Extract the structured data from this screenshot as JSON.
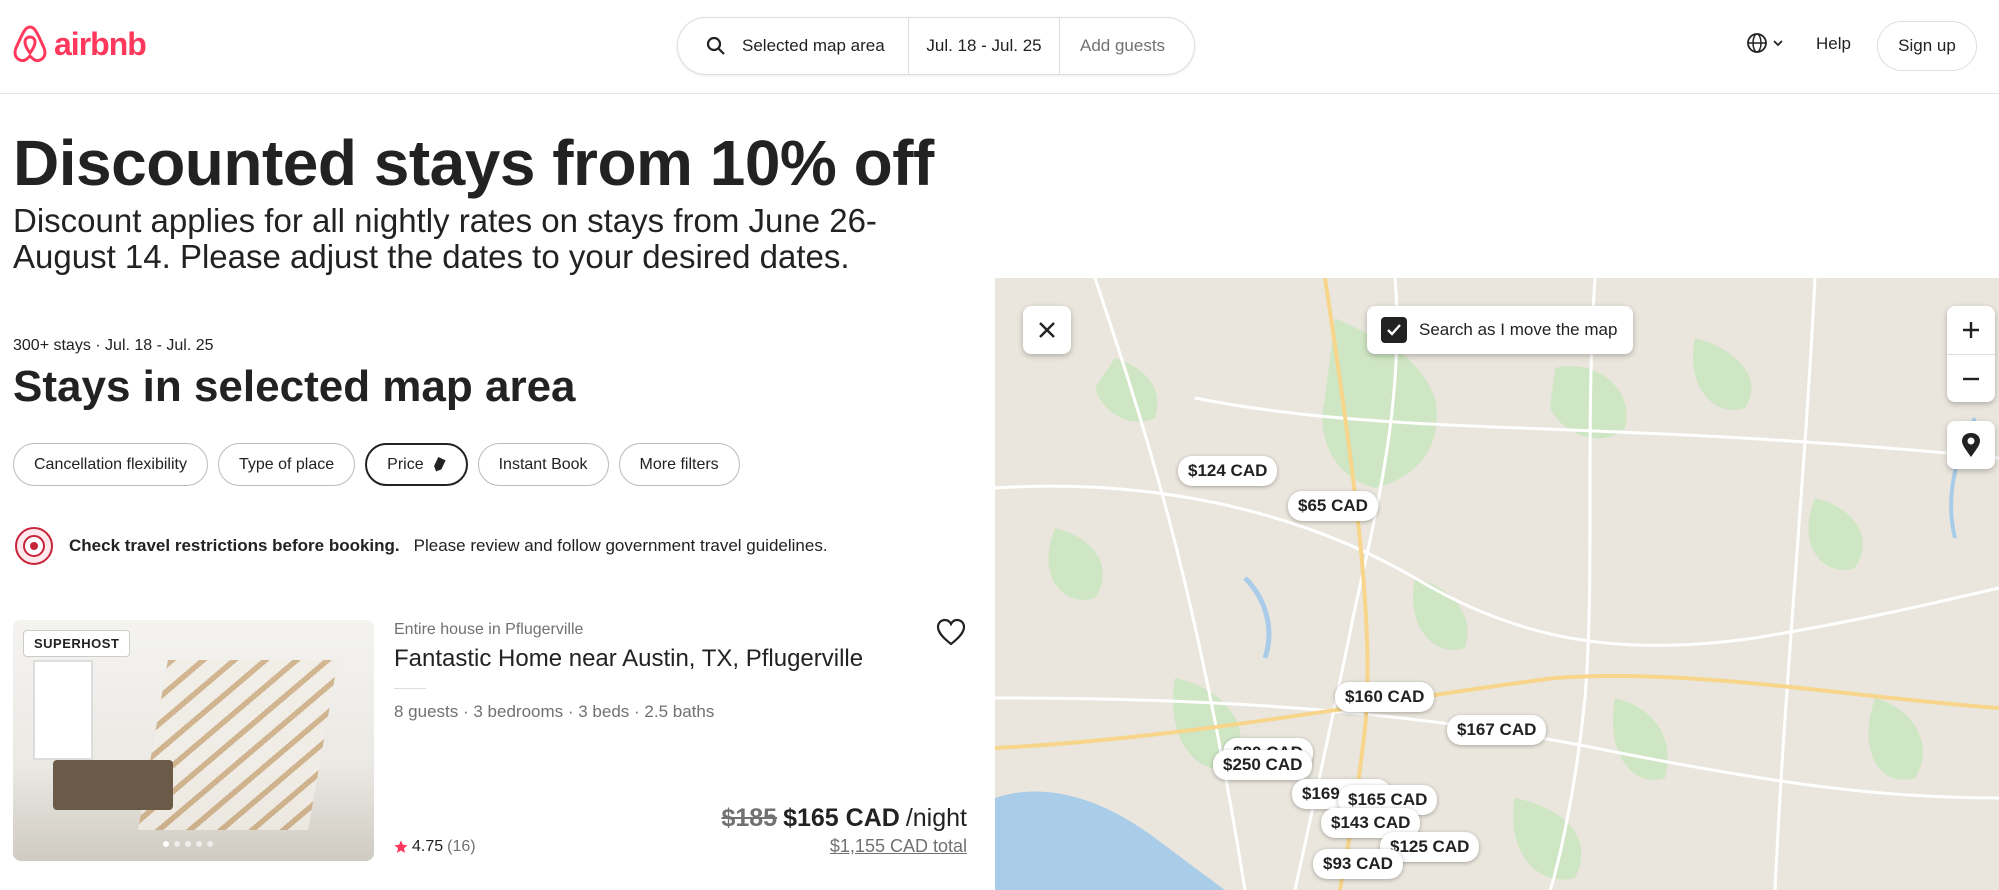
{
  "header": {
    "brand": "airbnb",
    "search": {
      "location": "Selected map area",
      "dates": "Jul. 18 - Jul. 25",
      "guests_placeholder": "Add guests"
    },
    "help_label": "Help",
    "signup_label": "Sign up"
  },
  "banner": {
    "title": "Discounted stays from 10% off",
    "subtitle": "Discount applies for all nightly rates on stays from June 26-August 14. Please adjust the dates to your desired dates."
  },
  "results": {
    "meta": "300+ stays · Jul. 18 - Jul. 25",
    "title": "Stays in selected map area"
  },
  "filters": [
    {
      "label": "Cancellation flexibility"
    },
    {
      "label": "Type of place"
    },
    {
      "label": "Price"
    },
    {
      "label": "Instant Book"
    },
    {
      "label": "More filters"
    }
  ],
  "travel_notice": {
    "bold": "Check travel restrictions before booking.",
    "rest": "Please review and follow government travel guidelines."
  },
  "listing": {
    "badge": "SUPERHOST",
    "kind": "Entire house in Pflugerville",
    "name": "Fantastic Home near Austin, TX, Pflugerville",
    "details": "8 guests · 3 bedrooms · 3 beds · 2.5 baths",
    "rating": "4.75",
    "review_count": "(16)",
    "old_price": "$185",
    "new_price": "$165 CAD",
    "per_night": "/night",
    "total": "$1,155 CAD total"
  },
  "map": {
    "search_as_move_label": "Search as I move the map",
    "search_as_move_checked": true,
    "prices": [
      {
        "label": "$124 CAD"
      },
      {
        "label": "$65 CAD"
      },
      {
        "label": "$160 CAD"
      },
      {
        "label": "$167 CAD"
      },
      {
        "label": "$80 CAD"
      },
      {
        "label": "$250 CAD"
      },
      {
        "label": "$169 CAD"
      },
      {
        "label": "$165 CAD"
      },
      {
        "label": "$143 CAD"
      },
      {
        "label": "$125 CAD"
      },
      {
        "label": "$93 CAD"
      }
    ]
  },
  "colors": {
    "brand": "#FF385C",
    "map_land": "#EAE6DD",
    "map_park": "#CFE6C4",
    "map_water": "#A9CCE9"
  }
}
